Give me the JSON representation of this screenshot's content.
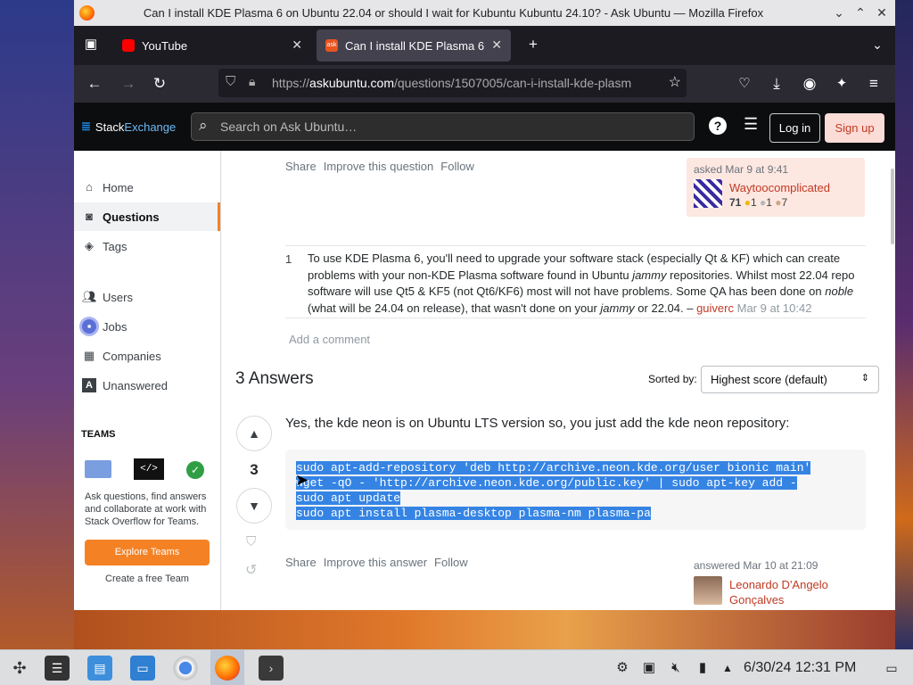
{
  "window": {
    "title": "Can I install KDE Plasma 6 on Ubuntu 22.04 or should I wait for Kubuntu Kubuntu 24.10? - Ask Ubuntu — Mozilla Firefox"
  },
  "tabs": [
    {
      "label": "YouTube"
    },
    {
      "label": "Can I install KDE Plasma 6"
    }
  ],
  "url": {
    "prefix": "https://",
    "domain": "askubuntu.com",
    "path": "/questions/1507005/can-i-install-kde-plasm"
  },
  "header": {
    "brand_a": "Stack",
    "brand_b": "Exchange",
    "search_placeholder": "Search on Ask Ubuntu…",
    "login": "Log in",
    "signup": "Sign up"
  },
  "sidebar": {
    "items": [
      {
        "label": "Home"
      },
      {
        "label": "Questions"
      },
      {
        "label": "Tags"
      },
      {
        "label": "Users"
      },
      {
        "label": "Jobs"
      },
      {
        "label": "Companies"
      },
      {
        "label": "Unanswered"
      }
    ],
    "teams_heading": "TEAMS",
    "teams_text": "Ask questions, find answers and collaborate at work with Stack Overflow for Teams.",
    "explore_button": "Explore Teams",
    "create_link": "Create a free Team"
  },
  "question": {
    "actions": [
      "Share",
      "Improve this question",
      "Follow"
    ],
    "asked": "asked Mar 9 at 9:41",
    "user": "Waytoocomplicated",
    "rep": "71",
    "gold": "1",
    "silver": "1",
    "bronze": "7"
  },
  "comment": {
    "score": "1",
    "p1": "To use KDE Plasma 6, you'll need to upgrade your software stack (especially Qt & KF) which can create problems with your non-KDE Plasma software found in Ubuntu ",
    "i1": "jammy",
    "p2": " repositories. Whilst most 22.04 repo software will use Qt5 & KF5 (not Qt6/KF6) most will not have problems. Some QA has been done on ",
    "i2": "noble",
    "p3": " (what will be 24.04 on release), that wasn't done on your ",
    "i3": "jammy",
    "p4": " or 22.04. – ",
    "user": "guiverc",
    "date": "Mar 9 at 10:42",
    "add": "Add a comment"
  },
  "answers": {
    "heading": "3 Answers",
    "sorted_label": "Sorted by:",
    "sort_value": "Highest score (default)",
    "score": "3",
    "text": "Yes, the kde neon is on Ubuntu LTS version so, you just add the kde neon repository:",
    "code": [
      "sudo apt-add-repository 'deb http://archive.neon.kde.org/user bionic main'",
      "wget -qO - 'http://archive.neon.kde.org/public.key' | sudo apt-key add -",
      "sudo apt update",
      "sudo apt install plasma-desktop plasma-nm plasma-pa"
    ],
    "actions": [
      "Share",
      "Improve this answer",
      "Follow"
    ],
    "answered": "answered Mar 10 at 21:09",
    "user": "Leonardo D'Angelo Gonçalves"
  },
  "taskbar": {
    "datetime": "6/30/24 12:31 PM"
  },
  "colors": {
    "accent": "#f48225",
    "link": "#c13a23",
    "selection": "#3584e4"
  }
}
